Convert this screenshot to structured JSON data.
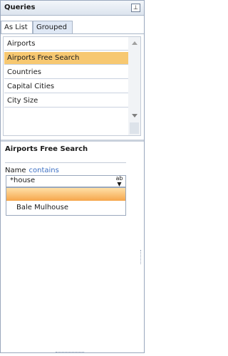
{
  "panel": {
    "title": "Queries"
  },
  "tabs": [
    {
      "label": "As List"
    },
    {
      "label": "Grouped"
    }
  ],
  "queries": [
    {
      "label": "Airports"
    },
    {
      "label": "Airports Free Search"
    },
    {
      "label": "Countries"
    },
    {
      "label": "Capital Cities"
    },
    {
      "label": "City Size"
    }
  ],
  "selected_query": "Airports Free Search",
  "detail": {
    "title": "Airports Free Search",
    "field_label": "Name",
    "operator": "contains",
    "value": "*house",
    "suggestions": [
      "Bale Mulhouse"
    ]
  },
  "icons": {
    "pin": "pin-icon",
    "combo_button": "ab-dropdown-icon",
    "scroll_up": "scroll-up-icon",
    "scroll_down": "scroll-down-icon"
  },
  "colors": {
    "selected_row": "#f7c871",
    "operator_text": "#3b6fc4",
    "highlight": "#f6a64b"
  }
}
